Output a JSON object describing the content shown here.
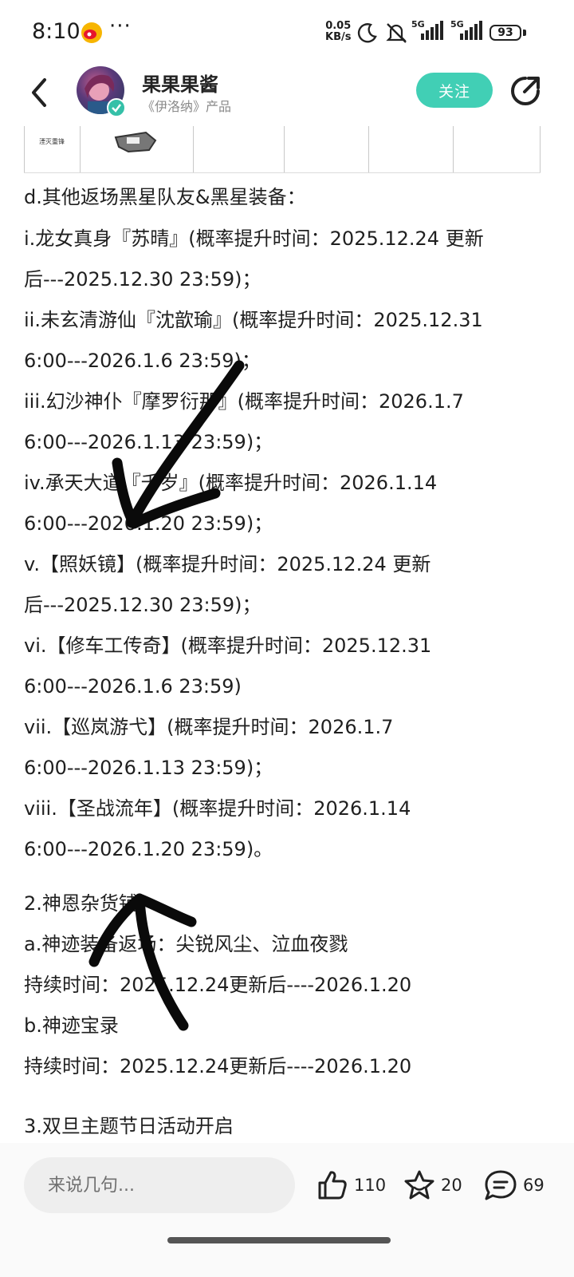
{
  "status_bar": {
    "time": "8:10",
    "more": "···",
    "net_speed_value": "0.05",
    "net_speed_unit": "KB/s",
    "sim1": "5G",
    "sim2": "5G",
    "battery": "93"
  },
  "header": {
    "account_name": "果果果酱",
    "account_subtitle": "《伊洛纳》产品",
    "follow_label": "关注"
  },
  "table_strip": {
    "first_cell_text": "湮灭重锋"
  },
  "article_lines": [
    "d.其他返场黑星队友&黑星装备：",
    "i.龙女真身『苏晴』(概率提升时间：2025.12.24 更新",
    "后---2025.12.30 23:59)；",
    "ii.未玄清游仙『沈歆瑜』(概率提升时间：2025.12.31",
    "6:00---2026.1.6 23:59)；",
    "iii.幻沙神仆『摩罗衍那』(概率提升时间：2026.1.7",
    "6:00---2026.1.13 23:59)；",
    "iv.承天大道『千岁』(概率提升时间：2026.1.14",
    "6:00---2026.1.20 23:59)；",
    "v.【照妖镜】(概率提升时间：2025.12.24 更新",
    "后---2025.12.30 23:59)；",
    "vi.【修车工传奇】(概率提升时间：2025.12.31",
    "6:00---2026.1.6 23:59)",
    "vii.【巡岚游弋】(概率提升时间：2026.1.7",
    "6:00---2026.1.13 23:59)；",
    "viii.【圣战流年】(概率提升时间：2026.1.14",
    "6:00---2026.1.20 23:59)。",
    "2.神恩杂货铺",
    "a.神迹装备返场：尖锐风尘、泣血夜戮",
    "持续时间：2025.12.24更新后----2026.1.20",
    "b.神迹宝录",
    "持续时间：2025.12.24更新后----2026.1.20",
    "3.双旦主题节日活动开启"
  ],
  "bottom_bar": {
    "comment_placeholder": "来说几句...",
    "like_count": "110",
    "favorite_count": "20",
    "comment_count": "69"
  },
  "icons": {
    "back": "chevron-left-icon",
    "share": "share-icon",
    "like": "thumbs-up-icon",
    "favorite": "star-icon",
    "comment": "comment-bubble-icon"
  },
  "colors": {
    "accent": "#41cfb5",
    "text": "#1f1f1f",
    "subtext": "#8a8a8a",
    "annotation": "#0a0a0a"
  }
}
